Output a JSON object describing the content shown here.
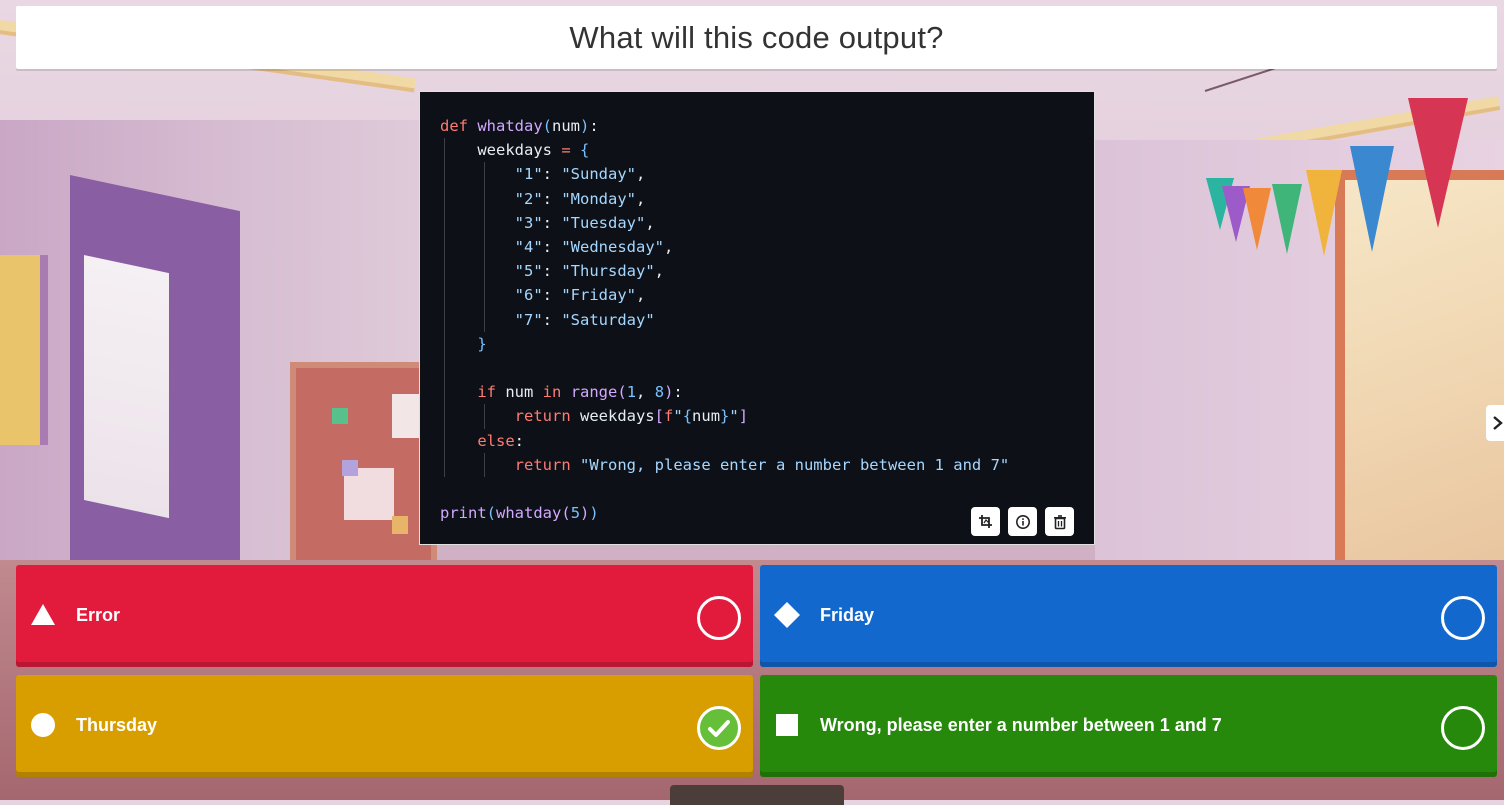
{
  "question": {
    "title": "What will this code output?"
  },
  "code_lines": [
    "def whatday(num):",
    "    weekdays = {",
    "        \"1\": \"Sunday\",",
    "        \"2\": \"Monday\",",
    "        \"3\": \"Tuesday\",",
    "        \"4\": \"Wednesday\",",
    "        \"5\": \"Thursday\",",
    "        \"6\": \"Friday\",",
    "        \"7\": \"Saturday\"",
    "    }",
    "",
    "    if num in range(1, 8):",
    "        return weekdays[f\"{num}\"]",
    "    else:",
    "        return \"Wrong, please enter a number between 1 and 7\"",
    "",
    "print(whatday(5))"
  ],
  "image_tools": {
    "items": [
      {
        "icon": "crop-icon"
      },
      {
        "icon": "info-icon"
      },
      {
        "icon": "trash-icon"
      }
    ]
  },
  "answers": [
    {
      "label": "Error",
      "shape": "triangle",
      "color": "#e21b3c",
      "correct": false
    },
    {
      "label": "Friday",
      "shape": "diamond",
      "color": "#1368ce",
      "correct": false
    },
    {
      "label": "Thursday",
      "shape": "circle",
      "color": "#d89e00",
      "correct": true
    },
    {
      "label": "Wrong, please enter a number between 1 and 7",
      "shape": "square",
      "color": "#26890c",
      "correct": false
    }
  ],
  "navigation": {
    "next_icon": "chevron-right-icon"
  }
}
